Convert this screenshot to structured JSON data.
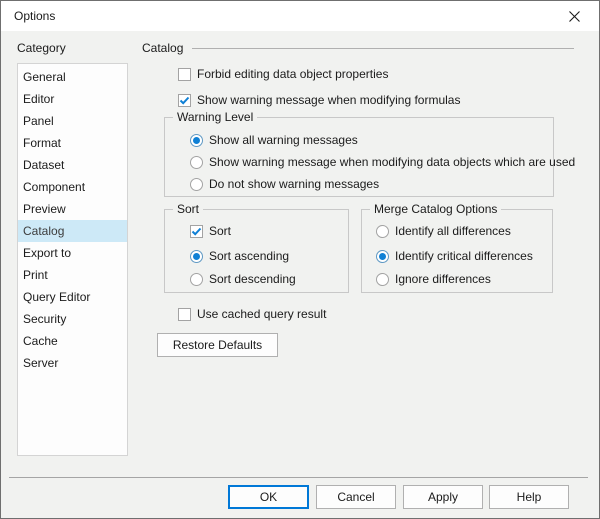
{
  "window": {
    "title": "Options",
    "close_icon": "close-x"
  },
  "sidebar": {
    "label": "Category",
    "selected_item": "Catalog",
    "items": [
      "General",
      "Editor",
      "Panel",
      "Format",
      "Dataset",
      "Component",
      "Preview",
      "Catalog",
      "Export to",
      "Print",
      "Query Editor",
      "Security",
      "Cache",
      "Server"
    ]
  },
  "content": {
    "section_title": "Catalog",
    "checkboxes": {
      "forbid": {
        "label": "Forbid editing data object properties",
        "checked": false
      },
      "show_warning": {
        "label": "Show warning message when modifying formulas",
        "checked": true
      },
      "use_cached": {
        "label": "Use cached query result",
        "checked": false
      }
    },
    "warning_level": {
      "title": "Warning Level",
      "options": [
        {
          "label": "Show all warning messages",
          "selected": true
        },
        {
          "label": "Show warning message when modifying data objects which are used",
          "selected": false
        },
        {
          "label": "Do not show warning messages",
          "selected": false
        }
      ]
    },
    "sort": {
      "title": "Sort",
      "checkbox": {
        "label": "Sort",
        "checked": true
      },
      "options": [
        {
          "label": "Sort ascending",
          "selected": true
        },
        {
          "label": "Sort descending",
          "selected": false
        }
      ]
    },
    "merge": {
      "title": "Merge Catalog Options",
      "options": [
        {
          "label": "Identify all differences",
          "selected": false
        },
        {
          "label": "Identify critical differences",
          "selected": true
        },
        {
          "label": "Ignore differences",
          "selected": false
        }
      ]
    },
    "restore_button": "Restore Defaults"
  },
  "footer": {
    "buttons": [
      "OK",
      "Cancel",
      "Apply",
      "Help"
    ],
    "default_button": "OK"
  },
  "colors": {
    "accent": "#0078d7",
    "selection_bg": "#cde9f7",
    "dialog_bg": "#f1f2f0",
    "titlebar_bg": "#ffffff"
  }
}
